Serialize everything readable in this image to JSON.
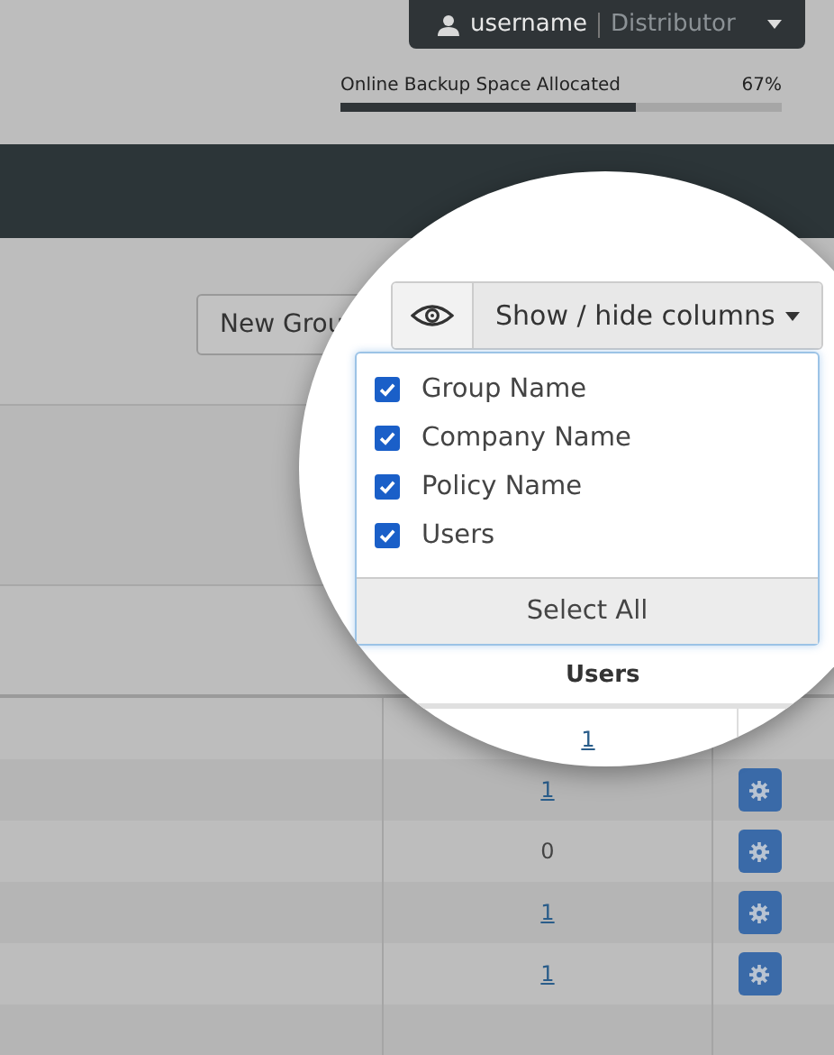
{
  "user_menu": {
    "username": "username",
    "role": "Distributor"
  },
  "storage": {
    "label": "Online Backup Space Allocated",
    "percent": "67%",
    "level": 0.67
  },
  "toolbar": {
    "new_group_button": "New Grou",
    "columns_button": "Show / hide columns"
  },
  "column_menu": {
    "items": [
      {
        "label": "Group Name",
        "checked": true
      },
      {
        "label": "Company Name",
        "checked": true
      },
      {
        "label": "Policy Name",
        "checked": true
      },
      {
        "label": "Users",
        "checked": true
      }
    ],
    "select_all": "Select All"
  },
  "table": {
    "users_header": "Users",
    "rows": [
      {
        "users": "1",
        "linked": true
      },
      {
        "users": "1",
        "linked": true
      },
      {
        "users": "0",
        "linked": false
      },
      {
        "users": "1",
        "linked": true
      },
      {
        "users": "1",
        "linked": true
      }
    ]
  }
}
